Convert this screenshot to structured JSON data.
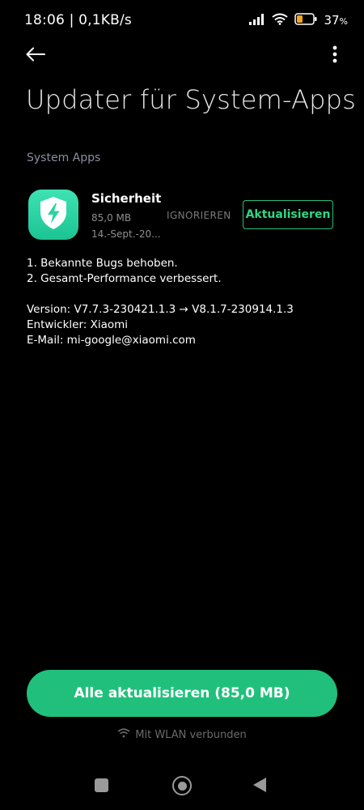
{
  "status_bar": {
    "time_net": "18:06 | 0,1KB/s",
    "battery_percent": "37",
    "battery_unit": "%",
    "battery_level": 0.37,
    "battery_color": "#f5a623"
  },
  "header": {
    "title": "Updater für System-Apps"
  },
  "section": {
    "label": "System Apps"
  },
  "app": {
    "name": "Sicherheit",
    "size": "85,0 MB",
    "date": "14.-Sept.-20...",
    "ignore_label": "IGNORIEREN",
    "update_label": "Aktualisieren",
    "icon": "shield-bolt-icon",
    "icon_color": "#2ed3a2"
  },
  "notes": {
    "lines": [
      "1. Bekannte Bugs behoben.",
      "2. Gesamt-Performance verbessert."
    ],
    "version": "Version: V7.7.3-230421.1.3 → V8.1.7-230914.1.3",
    "developer": "Entwickler: Xiaomi",
    "email": "E-Mail: mi-google@xiaomi.com"
  },
  "bottom": {
    "update_all_label": "Alle aktualisieren (85,0 MB)",
    "wifi_status": "Mit WLAN verbunden",
    "accent_color": "#20c07c"
  }
}
